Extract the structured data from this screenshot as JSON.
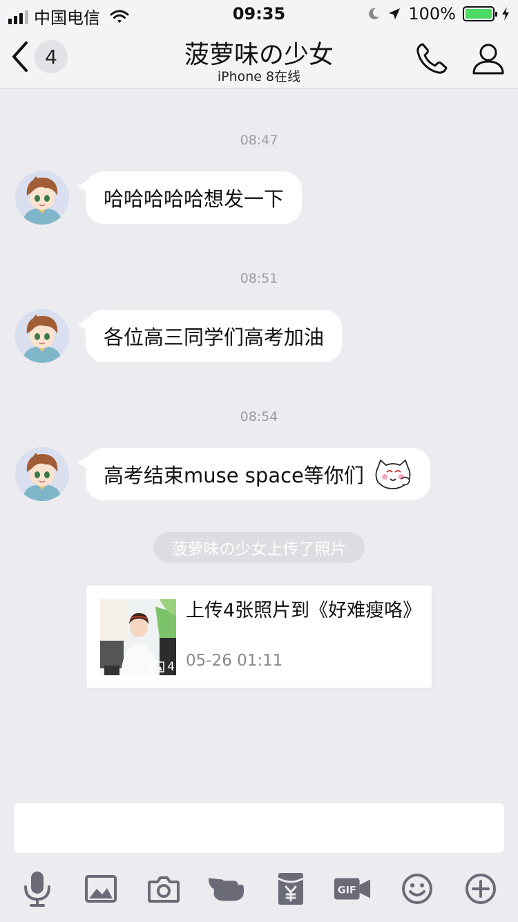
{
  "status_bar": {
    "carrier": "中国电信",
    "time": "09:35",
    "battery_percent": "100%",
    "battery_level": 1.0
  },
  "nav": {
    "back_count": "4",
    "title": "菠萝味の少女",
    "subtitle": "iPhone 8在线"
  },
  "messages": [
    {
      "timestamp": "08:47",
      "text": "哈哈哈哈哈想发一下"
    },
    {
      "timestamp": "08:51",
      "text": "各位高三同学们高考加油"
    },
    {
      "timestamp": "08:54",
      "text": "高考结束muse space等你们"
    }
  ],
  "system_notice": "菠萝味の少女上传了照片",
  "share_card": {
    "title": "上传4张照片到《好难瘦咯》",
    "date": "05-26 01:11",
    "photo_count": "4"
  },
  "input": {
    "value": "",
    "placeholder": ""
  },
  "toolbar_icons": [
    "microphone-icon",
    "image-icon",
    "camera-icon",
    "poke-icon",
    "red-packet-icon",
    "gif-icon",
    "emoji-icon",
    "plus-icon"
  ],
  "colors": {
    "background": "#ebebf0",
    "bar": "#f4f4f7",
    "bubble": "#ffffff",
    "icon": "#6b6b78",
    "battery": "#4cd964"
  }
}
